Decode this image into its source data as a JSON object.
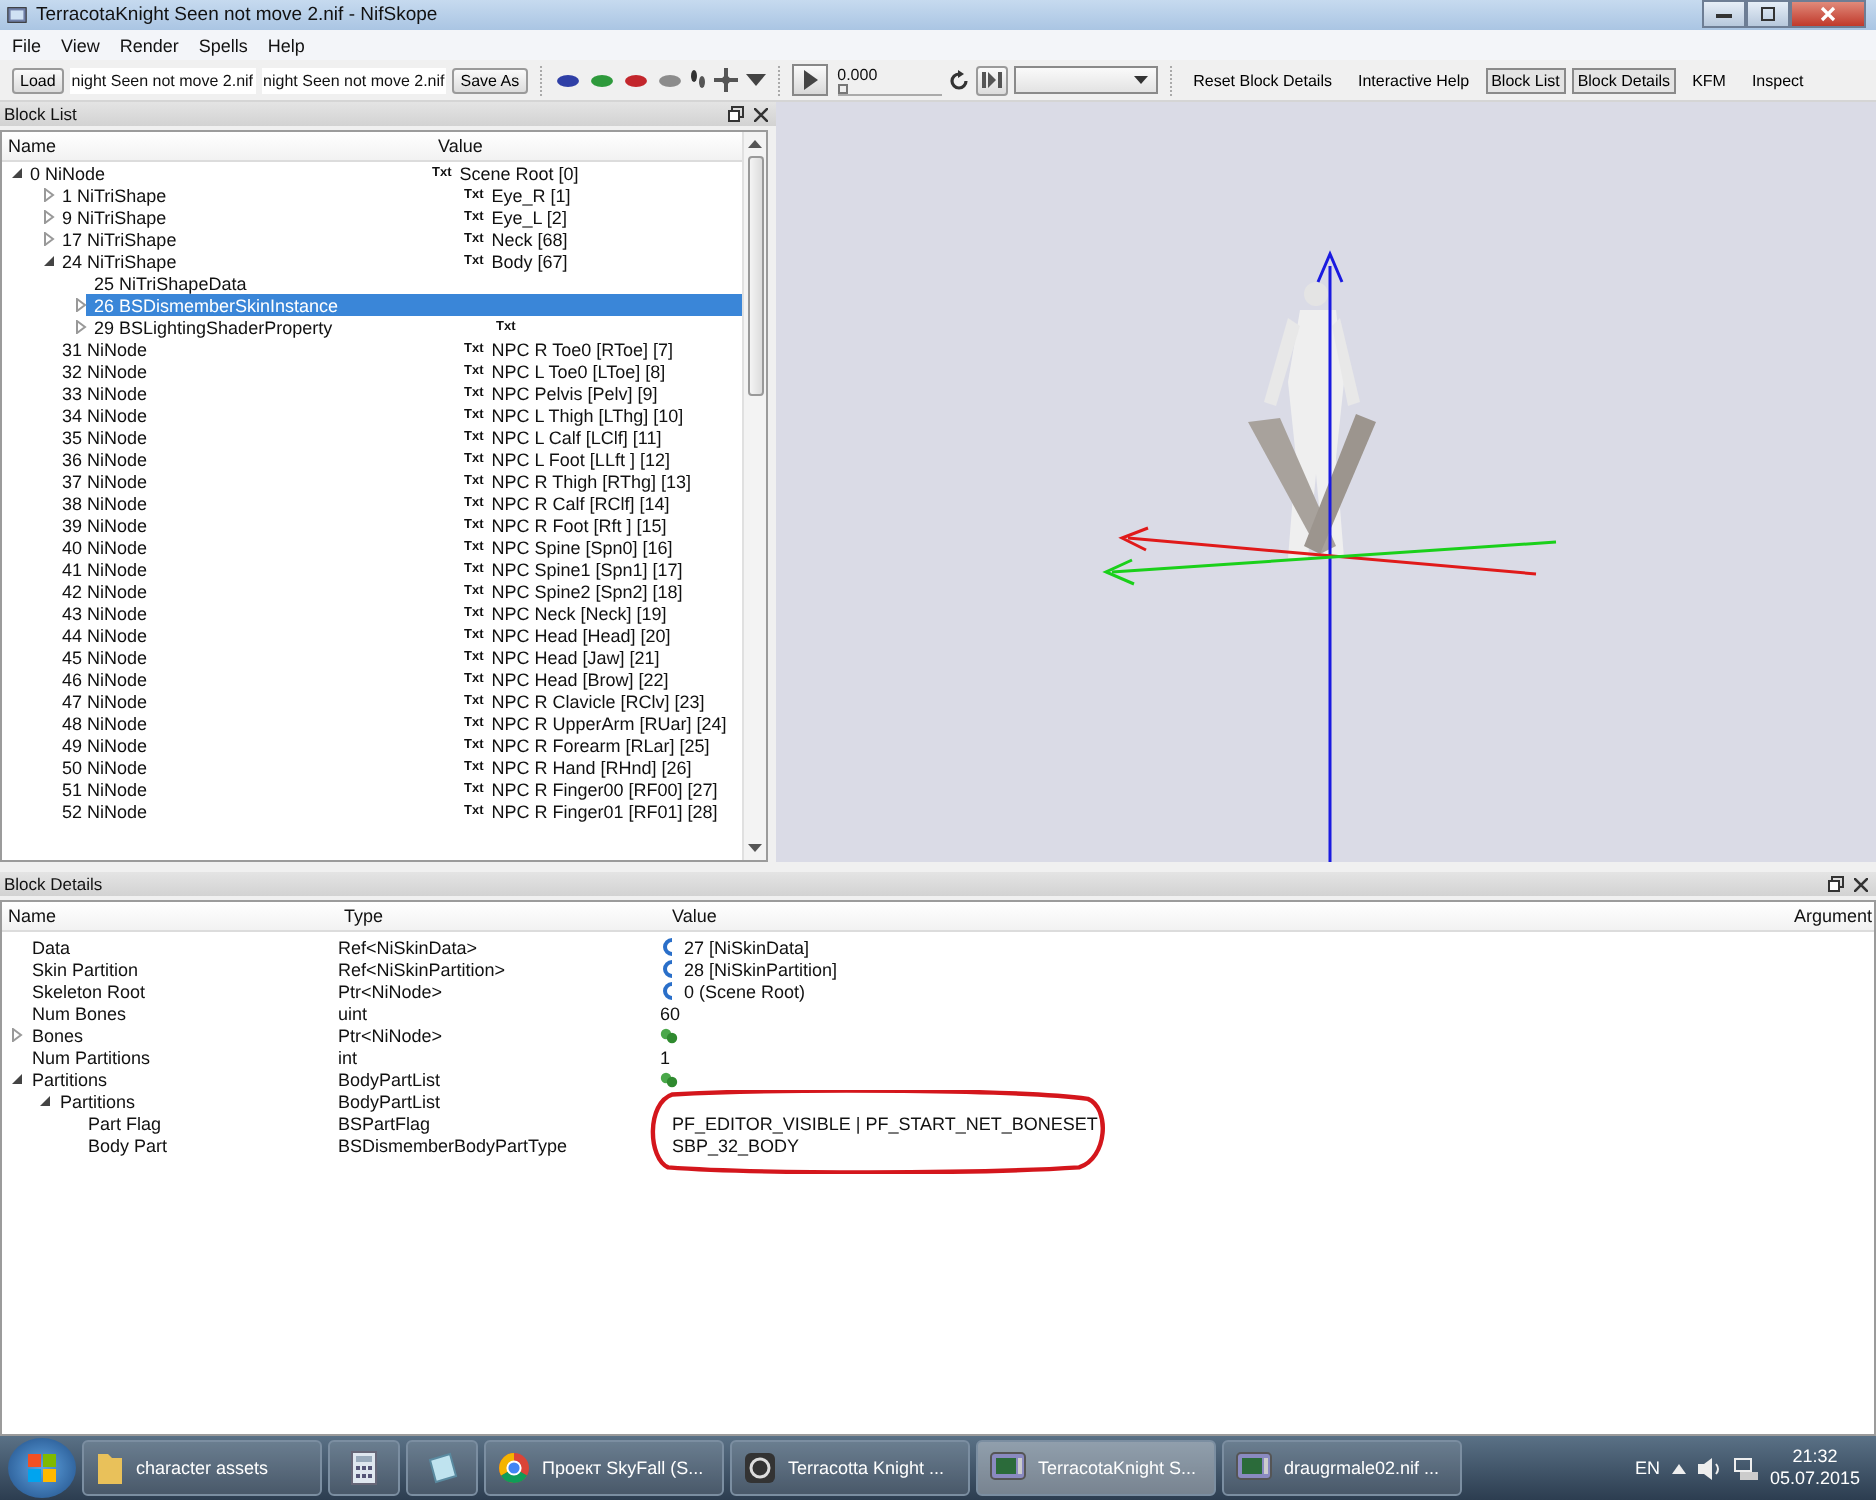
{
  "window": {
    "title": "TerracotaKnight Seen not move 2.nif - NifSkope"
  },
  "menu": [
    "File",
    "View",
    "Render",
    "Spells",
    "Help"
  ],
  "toolbar": {
    "load_button": "Load",
    "file_fields": [
      "night Seen not move 2.nif",
      "night Seen not move 2.nif"
    ],
    "save_button": "Save As",
    "view_toggles": [
      {
        "color": "#2f3fa6"
      },
      {
        "color": "#2e9a3c"
      },
      {
        "color": "#c3262c"
      },
      {
        "color": "#8c8c8c"
      }
    ],
    "time_value": "0.000",
    "time_slider": {
      "level": 0
    },
    "buttons": [
      {
        "label": "Reset Block Details",
        "checked": false
      },
      {
        "label": "Interactive Help",
        "checked": false
      },
      {
        "label": "Block List",
        "checked": true
      },
      {
        "label": "Block Details",
        "checked": true
      },
      {
        "label": "KFM",
        "checked": false
      },
      {
        "label": "Inspect",
        "checked": false
      }
    ]
  },
  "block_list": {
    "title": "Block List",
    "columns": [
      "Name",
      "Value"
    ],
    "rows": [
      {
        "name": "0 NiNode",
        "tag": "Txt",
        "value": "Scene Root [0]",
        "expanded": true,
        "selected": false,
        "children": [
          {
            "name": "1 NiTriShape",
            "tag": "Txt",
            "value": "Eye_R [1]",
            "expanded": false,
            "selected": false
          },
          {
            "name": "9 NiTriShape",
            "tag": "Txt",
            "value": "Eye_L [2]",
            "expanded": false,
            "selected": false
          },
          {
            "name": "17 NiTriShape",
            "tag": "Txt",
            "value": "Neck [68]",
            "expanded": false,
            "selected": false
          },
          {
            "name": "24 NiTriShape",
            "tag": "Txt",
            "value": "Body [67]",
            "expanded": true,
            "selected": false,
            "children": [
              {
                "name": "25 NiTriShapeData",
                "selected": false
              },
              {
                "name": "26 BSDismemberSkinInstance",
                "expanded": false,
                "selected": true
              },
              {
                "name": "29 BSLightingShaderProperty",
                "tag": "Txt",
                "expanded": false,
                "selected": false
              }
            ]
          },
          {
            "name": "31 NiNode",
            "tag": "Txt",
            "value": "NPC R Toe0 [RToe] [7]",
            "selected": false
          },
          {
            "name": "32 NiNode",
            "tag": "Txt",
            "value": "NPC L Toe0 [LToe] [8]",
            "selected": false
          },
          {
            "name": "33 NiNode",
            "tag": "Txt",
            "value": "NPC Pelvis [Pelv] [9]",
            "selected": false
          },
          {
            "name": "34 NiNode",
            "tag": "Txt",
            "value": "NPC L Thigh [LThg] [10]",
            "selected": false
          },
          {
            "name": "35 NiNode",
            "tag": "Txt",
            "value": "NPC L Calf [LClf] [11]",
            "selected": false
          },
          {
            "name": "36 NiNode",
            "tag": "Txt",
            "value": "NPC L Foot [LLft ] [12]",
            "selected": false
          },
          {
            "name": "37 NiNode",
            "tag": "Txt",
            "value": "NPC R Thigh [RThg] [13]",
            "selected": false
          },
          {
            "name": "38 NiNode",
            "tag": "Txt",
            "value": "NPC R Calf [RClf] [14]",
            "selected": false
          },
          {
            "name": "39 NiNode",
            "tag": "Txt",
            "value": "NPC R Foot [Rft ] [15]",
            "selected": false
          },
          {
            "name": "40 NiNode",
            "tag": "Txt",
            "value": "NPC Spine [Spn0] [16]",
            "selected": false
          },
          {
            "name": "41 NiNode",
            "tag": "Txt",
            "value": "NPC Spine1 [Spn1] [17]",
            "selected": false
          },
          {
            "name": "42 NiNode",
            "tag": "Txt",
            "value": "NPC Spine2 [Spn2] [18]",
            "selected": false
          },
          {
            "name": "43 NiNode",
            "tag": "Txt",
            "value": "NPC Neck [Neck] [19]",
            "selected": false
          },
          {
            "name": "44 NiNode",
            "tag": "Txt",
            "value": "NPC Head [Head] [20]",
            "selected": false
          },
          {
            "name": "45 NiNode",
            "tag": "Txt",
            "value": "NPC Head [Jaw] [21]",
            "selected": false
          },
          {
            "name": "46 NiNode",
            "tag": "Txt",
            "value": "NPC Head [Brow] [22]",
            "selected": false
          },
          {
            "name": "47 NiNode",
            "tag": "Txt",
            "value": "NPC R Clavicle [RClv] [23]",
            "selected": false
          },
          {
            "name": "48 NiNode",
            "tag": "Txt",
            "value": "NPC R UpperArm [RUar] [24]",
            "selected": false
          },
          {
            "name": "49 NiNode",
            "tag": "Txt",
            "value": "NPC R Forearm [RLar] [25]",
            "selected": false
          },
          {
            "name": "50 NiNode",
            "tag": "Txt",
            "value": "NPC R Hand [RHnd] [26]",
            "selected": false
          },
          {
            "name": "51 NiNode",
            "tag": "Txt",
            "value": "NPC R Finger00 [RF00] [27]",
            "selected": false
          },
          {
            "name": "52 NiNode",
            "tag": "Txt",
            "value": "NPC R Finger01 [RF01] [28]",
            "selected": false
          }
        ]
      }
    ]
  },
  "block_details": {
    "title": "Block Details",
    "columns": [
      "Name",
      "Type",
      "Value",
      "Argument"
    ],
    "rows": [
      {
        "name": "Data",
        "type": "Ref<NiSkinData>",
        "value": "27 [NiSkinData]",
        "kind": "link"
      },
      {
        "name": "Skin Partition",
        "type": "Ref<NiSkinPartition>",
        "value": "28 [NiSkinPartition]",
        "kind": "link"
      },
      {
        "name": "Skeleton Root",
        "type": "Ptr<NiNode>",
        "value": "0 (Scene Root)",
        "kind": "link"
      },
      {
        "name": "Num Bones",
        "type": "uint",
        "value": "60"
      },
      {
        "name": "Bones",
        "type": "Ptr<NiNode>",
        "kind": "array",
        "expanded": false
      },
      {
        "name": "Num Partitions",
        "type": "int",
        "value": "1"
      },
      {
        "name": "Partitions",
        "type": "BodyPartList",
        "kind": "array",
        "expanded": true,
        "children": [
          {
            "name": "Partitions",
            "type": "BodyPartList",
            "expanded": true,
            "children": [
              {
                "name": "Part Flag",
                "type": "BSPartFlag",
                "value": "PF_EDITOR_VISIBLE | PF_START_NET_BONESET",
                "circled": true
              },
              {
                "name": "Body Part",
                "type": "BSDismemberBodyPartType",
                "value": "SBP_32_BODY",
                "circled": true
              }
            ]
          }
        ]
      }
    ]
  },
  "taskbar": {
    "items": [
      {
        "label": "character assets",
        "kind": "folder",
        "selected": false
      },
      {
        "kind": "calculator",
        "selected": false
      },
      {
        "kind": "notepad",
        "selected": false
      },
      {
        "label": "Проект SkyFall (S...",
        "kind": "browser",
        "selected": false
      },
      {
        "label": "Terracotta Knight ...",
        "kind": "app",
        "selected": false
      },
      {
        "label": "TerracotaKnight S...",
        "kind": "monitor",
        "selected": true
      },
      {
        "label": "draugrmale02.nif ...",
        "kind": "monitor",
        "selected": false
      }
    ],
    "language": "EN",
    "time": "21:32",
    "date": "05.07.2015"
  }
}
